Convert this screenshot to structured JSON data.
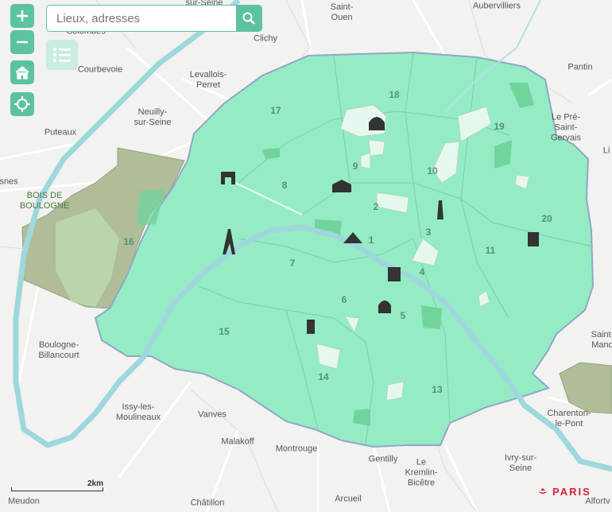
{
  "search": {
    "placeholder": "Lieux, adresses"
  },
  "icons": {
    "zoom_in": "plus-icon",
    "zoom_out": "minus-icon",
    "home": "home-icon",
    "locate": "crosshair-icon",
    "search": "search-icon",
    "list": "list-icon"
  },
  "colors": {
    "paris_fill": "#95ecc4",
    "park": "#e6f8ee",
    "bois": "#a9b88f",
    "river": "#9fd8dc",
    "accent": "#5cc2a0",
    "brand": "#d41f3a"
  },
  "scale": {
    "label": "2km"
  },
  "logo": {
    "text": "PARIS"
  },
  "places": [
    "sur-Seine",
    "Saint-\nOuen",
    "Aubervilliers",
    "Colombes",
    "Clichy",
    "Courbevoie",
    "Levallois-\nPerret",
    "Pantin",
    "Neuilly-\nsur-Seine",
    "Le Pré-\nSaint-\nGervais",
    "Puteaux",
    "esnes",
    "Boulogne-\nBillancourt",
    "Saint-\nMand",
    "Issy-les-\nMoulineaux",
    "Vanves",
    "Malakoff",
    "Montrouge",
    "Gentilly",
    "Le\nKremlin-\nBicêtre",
    "Ivry-sur-\nSeine",
    "Charenton-\nle-Pont",
    "Meudon",
    "Châtillon",
    "Arcueil",
    "Alfortv",
    "Li"
  ],
  "parks": [
    "BOIS DE\nBOULOGNE"
  ],
  "arrondissements": [
    "1",
    "2",
    "3",
    "4",
    "5",
    "6",
    "7",
    "8",
    "9",
    "10",
    "11",
    "13",
    "14",
    "15",
    "16",
    "17",
    "18",
    "19",
    "20"
  ]
}
